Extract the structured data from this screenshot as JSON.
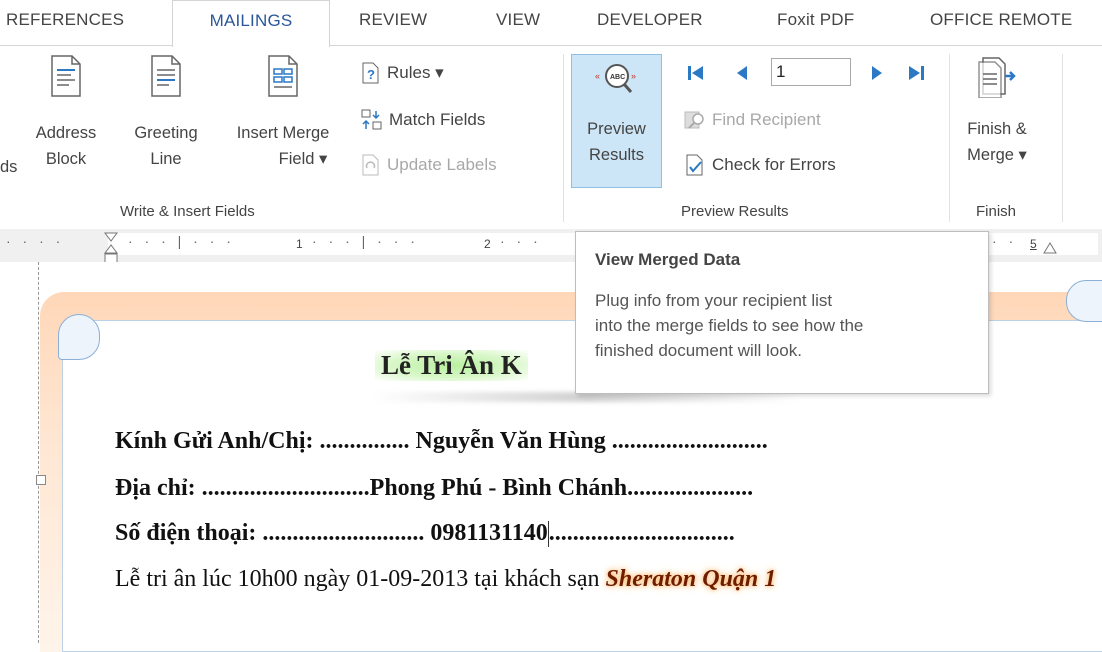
{
  "tabs": {
    "references": "REFERENCES",
    "mailings": "MAILINGS",
    "review": "REVIEW",
    "view": "VIEW",
    "developer": "DEVELOPER",
    "foxit": "Foxit PDF",
    "office_remote": "OFFICE REMOTE"
  },
  "ribbon": {
    "partial_left": "ds",
    "address_block": {
      "line1": "Address",
      "line2": "Block",
      "icon": "address-block-icon"
    },
    "greeting_line": {
      "line1": "Greeting",
      "line2": "Line",
      "icon": "greeting-line-icon"
    },
    "insert_merge_field": {
      "line1": "Insert Merge",
      "line2": "Field ▾",
      "icon": "insert-merge-field-icon"
    },
    "rules": "Rules ▾",
    "match_fields": "Match Fields",
    "update_labels": "Update Labels",
    "group_write_insert": "Write & Insert Fields",
    "preview_results": {
      "line1": "Preview",
      "line2": "Results",
      "icon": "abc-preview-icon"
    },
    "record_number": "1",
    "find_recipient": "Find Recipient",
    "check_errors": "Check for Errors",
    "group_preview": "Preview Results",
    "finish_merge": {
      "line1": "Finish &",
      "line2": "Merge ▾",
      "icon": "finish-merge-icon"
    },
    "group_finish": "Finish"
  },
  "ruler": {
    "n1": "1",
    "n2": "2",
    "n5": "5"
  },
  "tooltip": {
    "title": "View Merged Data",
    "body_lines": [
      "Plug info from your recipient list",
      "into the merge fields to see how the",
      "finished document will look."
    ]
  },
  "document": {
    "title": "Lễ Tri Ân K",
    "line1_label": "Kính Gửi Anh/Chị: ...............",
    "line1_value": " Nguyễn Văn Hùng ",
    "line1_tail": "..........................",
    "line2_label": "Địa chỉ: ............................",
    "line2_value": "Phong Phú - Bình Chánh",
    "line2_tail": ".....................",
    "line3_label": "Số điện thoại: ...........................",
    "line3_value": " 0981131140",
    "line3_tail": "...............................",
    "line4_text": "Lễ tri ân lúc 10h00 ngày 01-09-2013 tại khách sạn ",
    "line4_highlight": "Sheraton Quận 1"
  },
  "colors": {
    "accent": "#2b579a",
    "preview_bg": "#cde6f7",
    "glow": "#ffd7b8",
    "title_highlight": "#b9f0a0"
  }
}
